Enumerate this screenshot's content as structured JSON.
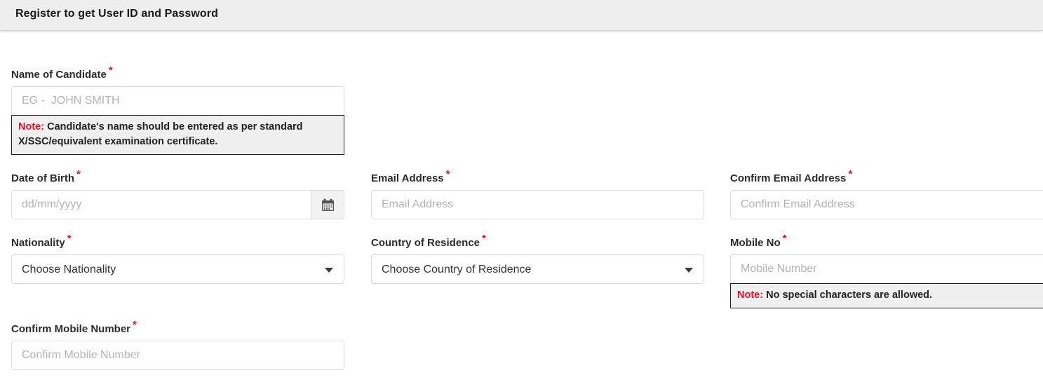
{
  "header": {
    "title": "Register to get User ID and Password"
  },
  "form": {
    "required_marker": "*",
    "fields": {
      "name": {
        "label": "Name of Candidate",
        "placeholder": "EG -  JOHN SMITH",
        "value": "",
        "note_label": "Note:",
        "note_text": "Candidate's name should be entered as per standard X/SSC/equivalent examination certificate."
      },
      "dob": {
        "label": "Date of Birth",
        "placeholder": "dd/mm/yyyy",
        "value": "",
        "icon": "calendar-icon"
      },
      "email": {
        "label": "Email Address",
        "placeholder": "Email Address",
        "value": ""
      },
      "confirm_email": {
        "label": "Confirm Email Address",
        "placeholder": "Confirm Email Address",
        "value": ""
      },
      "nationality": {
        "label": "Nationality",
        "selected": "Choose Nationality",
        "options": [
          "Choose Nationality"
        ]
      },
      "country_of_residence": {
        "label": "Country of Residence",
        "selected": "Choose Country of Residence",
        "options": [
          "Choose Country of Residence"
        ]
      },
      "mobile": {
        "label": "Mobile No",
        "placeholder": "Mobile Number",
        "value": "",
        "note_label": "Note:",
        "note_text": "No special characters are allowed."
      },
      "confirm_mobile": {
        "label": "Confirm Mobile Number",
        "placeholder": "Confirm Mobile Number",
        "value": ""
      }
    }
  },
  "colors": {
    "required_red": "#e8112d",
    "header_bg": "#eeeeee",
    "note_bg": "#efefef",
    "note_border": "#222222",
    "input_border": "#dcdcdc"
  }
}
